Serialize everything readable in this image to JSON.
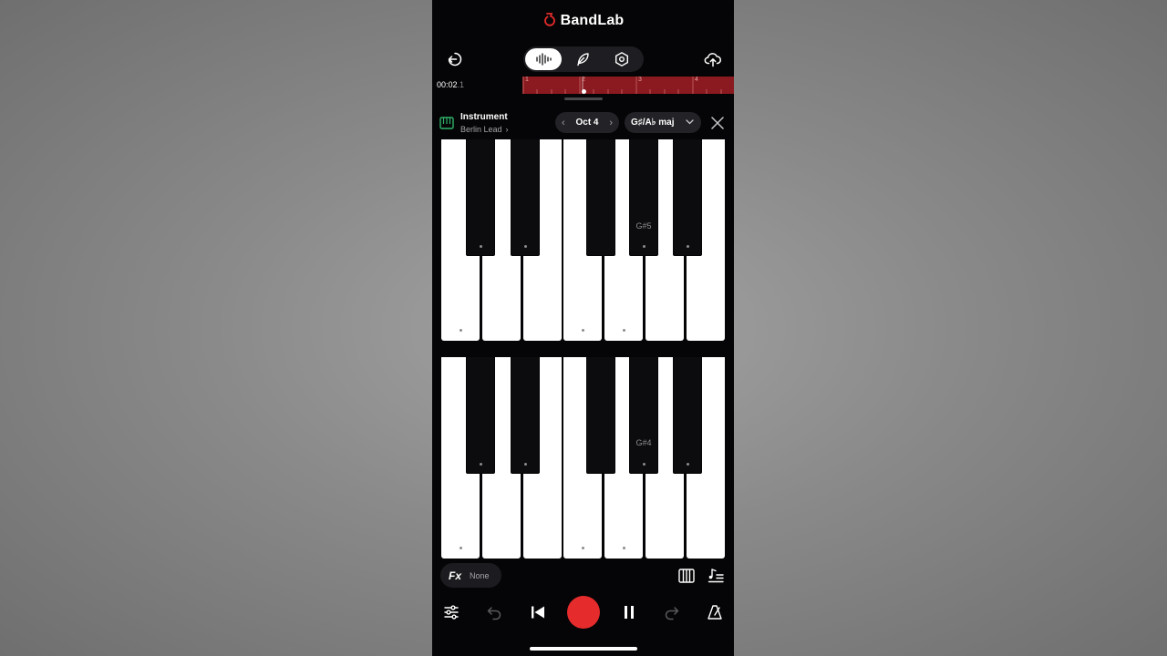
{
  "app": {
    "brand_name": "BandLab",
    "brand_color": "#e52b2b"
  },
  "toolbar": {
    "exit_icon": "exit-icon",
    "modes": [
      "waveform-icon",
      "feather-icon",
      "hexagon-settings-icon"
    ],
    "active_mode_index": 0,
    "upload_icon": "cloud-upload-icon"
  },
  "transport_time": {
    "main": "00:02",
    "tenth": ".1"
  },
  "timeline": {
    "bar_labels": [
      "1",
      "2",
      "3",
      "4"
    ],
    "region_color": "#8a1a1f"
  },
  "instrument": {
    "title": "Instrument",
    "preset": "Berlin Lead",
    "octave_label": "Oct 4",
    "scale_label": "G♯/A♭ maj",
    "icon_color": "#2fb36a"
  },
  "keyboards": [
    {
      "label": "G#5",
      "label_key": "G#"
    },
    {
      "label": "G#4",
      "label_key": "G#"
    }
  ],
  "fx": {
    "label": "Fx",
    "value": "None"
  },
  "bottom_bar": {
    "icons": [
      "mixer-icon",
      "undo-icon",
      "skip-back-icon",
      "record-button",
      "pause-icon",
      "redo-icon",
      "metronome-icon"
    ],
    "record_color": "#e52b2b"
  }
}
